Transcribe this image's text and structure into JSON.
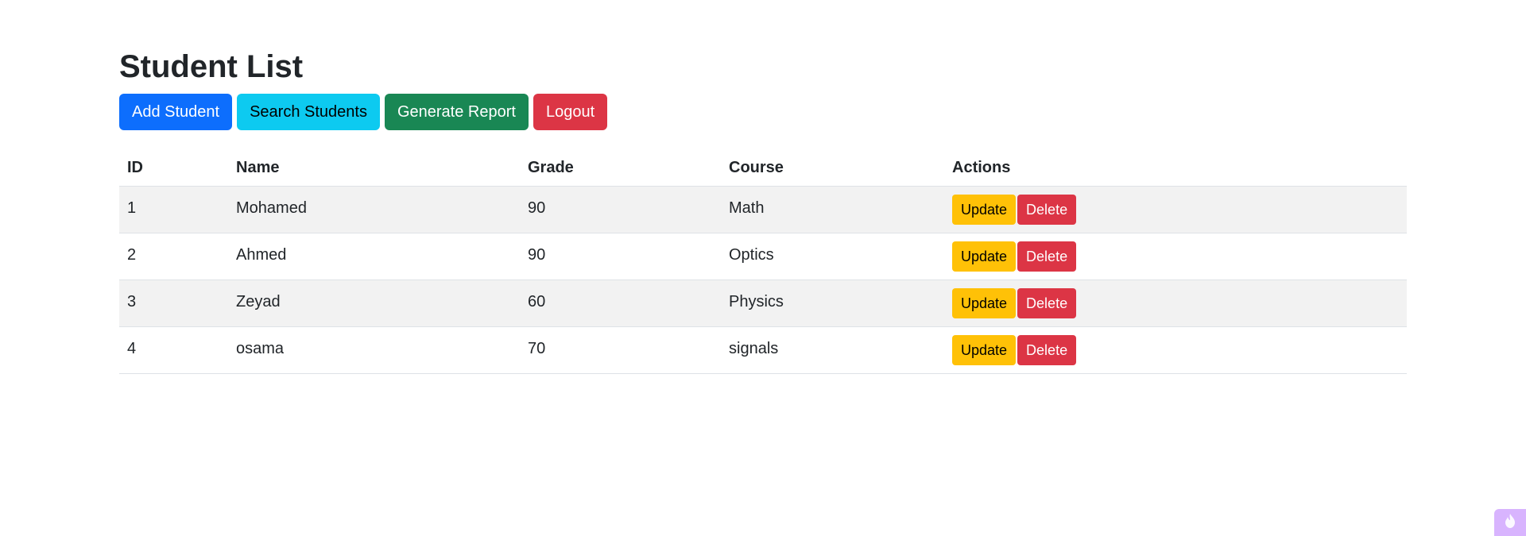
{
  "page": {
    "title": "Student List"
  },
  "toolbar": {
    "add_label": "Add Student",
    "search_label": "Search Students",
    "report_label": "Generate Report",
    "logout_label": "Logout"
  },
  "table": {
    "headers": [
      "ID",
      "Name",
      "Grade",
      "Course",
      "Actions"
    ],
    "rows": [
      {
        "id": "1",
        "name": "Mohamed",
        "grade": "90",
        "course": "Math"
      },
      {
        "id": "2",
        "name": "Ahmed",
        "grade": "90",
        "course": "Optics"
      },
      {
        "id": "3",
        "name": "Zeyad",
        "grade": "60",
        "course": "Physics"
      },
      {
        "id": "4",
        "name": "osama",
        "grade": "70",
        "course": "signals"
      }
    ],
    "update_label": "Update",
    "delete_label": "Delete"
  },
  "colors": {
    "primary": "#0d6efd",
    "info": "#0dcaf0",
    "success": "#198754",
    "danger": "#dc3545",
    "warning": "#ffc107",
    "badge": "#d8b4fe"
  },
  "icons": {
    "corner_badge": "flame-icon"
  }
}
